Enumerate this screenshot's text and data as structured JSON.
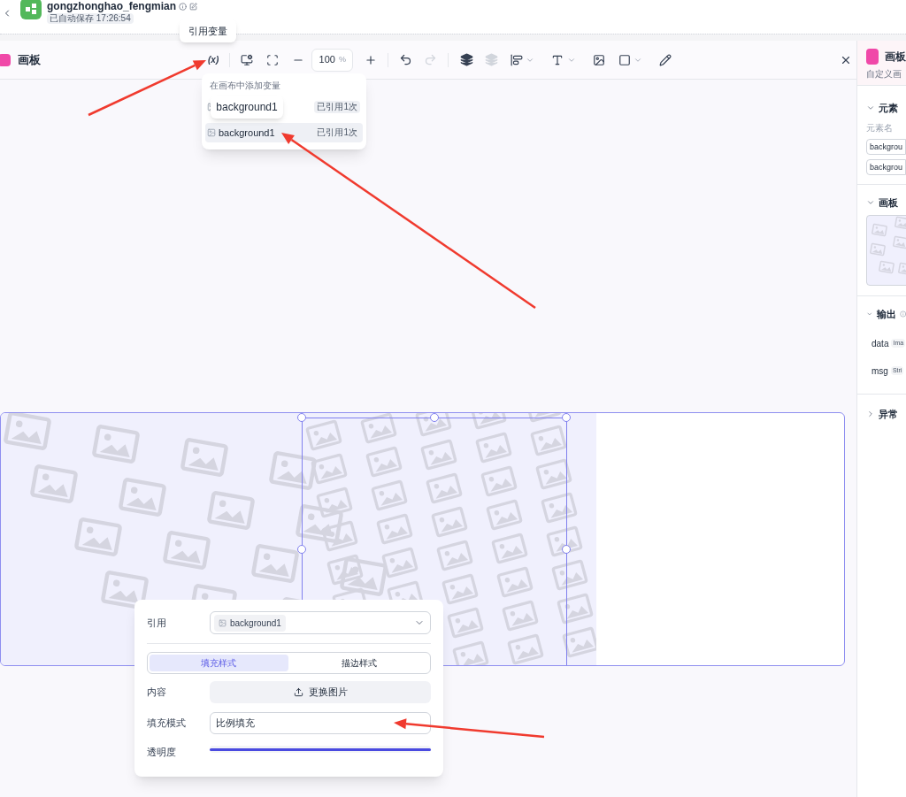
{
  "header": {
    "title": "gongzhonghao_fengmian",
    "autosave": "已自动保存 17:26:54"
  },
  "tooltip": "引用变量",
  "panel": {
    "title": "画板",
    "variable_button": "(x)",
    "zoom": "100",
    "zoom_unit": "%",
    "tools": [
      {
        "kind": "undo",
        "disabled": false
      },
      {
        "kind": "redo",
        "disabled": true
      },
      {
        "kind": "layer-up",
        "disabled": false
      },
      {
        "kind": "layer-down",
        "disabled": true
      }
    ]
  },
  "variable_menu": {
    "heading": "在画布中添加变量",
    "hover_tooltip": "background1",
    "items": [
      {
        "badge": "已引用1次",
        "selected": false
      },
      {
        "name": "background1",
        "badge": "已引用1次",
        "selected": true
      }
    ]
  },
  "properties": {
    "reference_label": "引用",
    "reference_value": "background1",
    "tabs": [
      {
        "label": "填充样式",
        "selected": true
      },
      {
        "label": "描边样式",
        "selected": false
      }
    ],
    "content_label": "内容",
    "replace_button": "更换图片",
    "fill_mode_label": "填充模式",
    "fill_mode": "比例填充",
    "opacity_label": "透明度",
    "opacity": {
      "level": 1
    }
  },
  "sidebar": {
    "title": "画板",
    "subtitle": "自定义画",
    "element_section": "元素",
    "element_name_label": "元素名",
    "element_inputs": [
      "backgrou",
      "backgrou"
    ],
    "board_section": "画板",
    "output_section": "输出",
    "outputs": [
      {
        "name": "data",
        "type": "Ima"
      },
      {
        "name": "msg",
        "type": "Stri"
      }
    ],
    "error_section": "异常"
  }
}
